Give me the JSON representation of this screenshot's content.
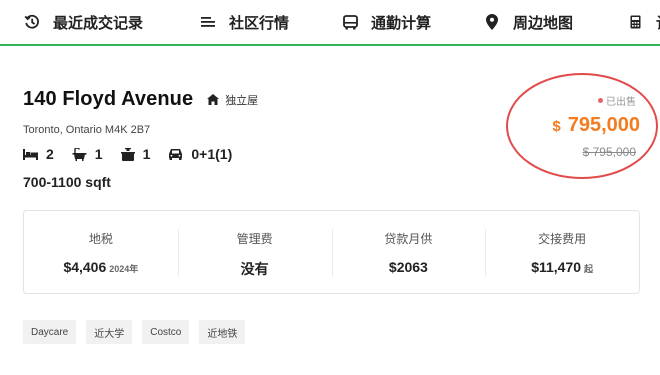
{
  "nav": {
    "items": [
      {
        "label": "最近成交记录",
        "icon": "history-icon"
      },
      {
        "label": "社区行情",
        "icon": "list-icon"
      },
      {
        "label": "通勤计算",
        "icon": "bus-icon"
      },
      {
        "label": "周边地图",
        "icon": "map-pin-icon"
      },
      {
        "label": "计",
        "icon": "calculator-icon"
      }
    ],
    "accent_color": "#2fb65a"
  },
  "listing": {
    "address": "140 Floyd Avenue",
    "property_type": "独立屋",
    "city": "Toronto, Ontario M4K 2B7",
    "features": {
      "beds": "2",
      "baths": "1",
      "kitchens": "1",
      "parking": "0+1(1)"
    },
    "sqft": "700-1100 sqft"
  },
  "price": {
    "status": "已出售",
    "currency": "$",
    "sold_price": "795,000",
    "original_price": "$ 795,000",
    "price_color": "#f47b20",
    "status_dot_color": "#e8626b",
    "highlight_color": "#e14b4b"
  },
  "stats": [
    {
      "label": "地税",
      "value": "$4,406",
      "sub": "2024年"
    },
    {
      "label": "管理费",
      "value": "没有",
      "sub": ""
    },
    {
      "label": "贷款月供",
      "value": "$2063",
      "sub": ""
    },
    {
      "label": "交接费用",
      "value": "$11,470",
      "sub": "起"
    }
  ],
  "tags": [
    "Daycare",
    "近大学",
    "Costco",
    "近地铁"
  ]
}
